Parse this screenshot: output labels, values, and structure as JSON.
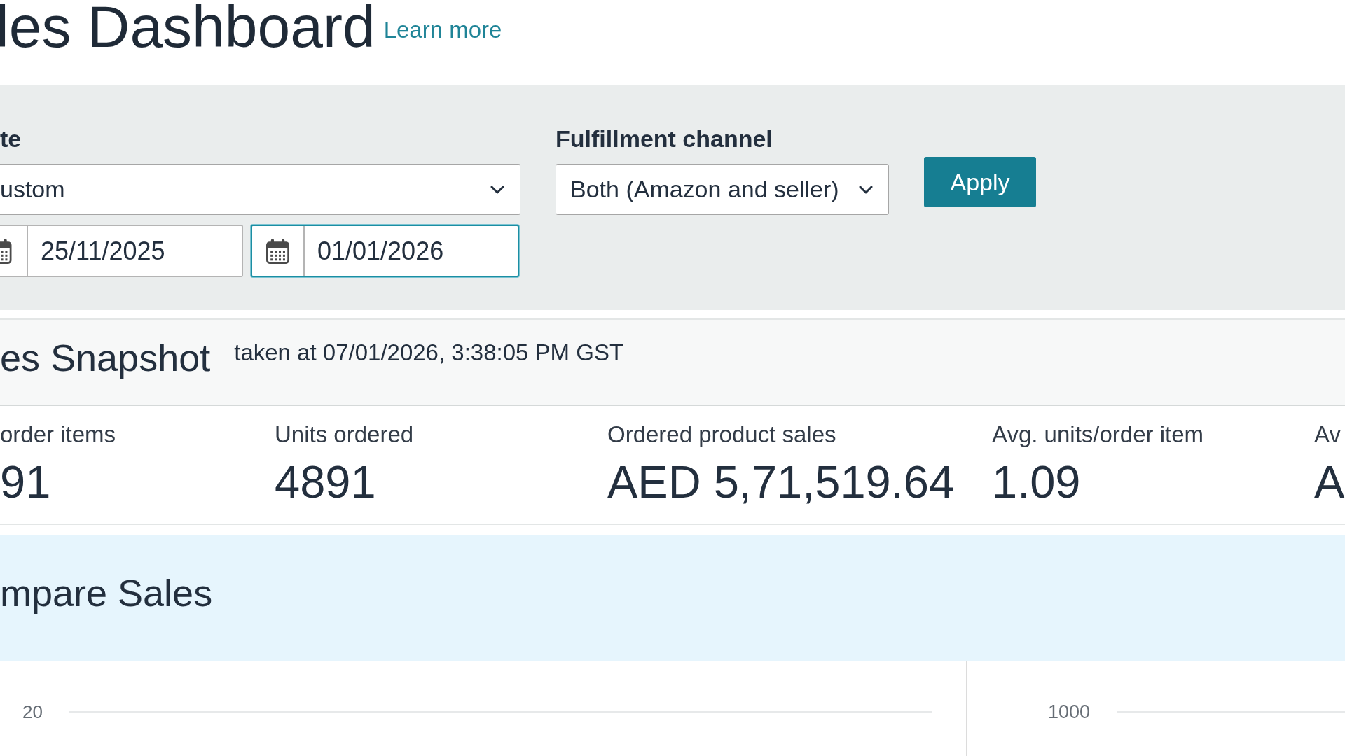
{
  "page_header": {
    "title": "les Dashboard",
    "learn_more_link": "Learn more"
  },
  "filters": {
    "date": {
      "label": "te",
      "select_value": "ustom",
      "date_fields": [
        {
          "value": "25/11/2025",
          "focused": false
        },
        {
          "value": "01/01/2026",
          "focused": true
        }
      ]
    },
    "fulfillment_channel": {
      "label": "Fulfillment channel",
      "select_value": "Both (Amazon and seller)"
    },
    "apply_button": "Apply"
  },
  "snapshot": {
    "title": "es Snapshot",
    "timestamp": "taken at 07/01/2026, 3:38:05 PM GST",
    "metrics": [
      {
        "label": "order items",
        "value": "91"
      },
      {
        "label": "Units ordered",
        "value": "4891"
      },
      {
        "label": "Ordered product sales",
        "value": "AED 5,71,519.64"
      },
      {
        "label": "Avg. units/order item",
        "value": "1.09"
      },
      {
        "label": "Av",
        "value": "A"
      }
    ]
  },
  "compare_sales": {
    "title": "mpare Sales",
    "charts": [
      {
        "y_tick": "20"
      },
      {
        "y_tick": "1000"
      }
    ]
  }
}
